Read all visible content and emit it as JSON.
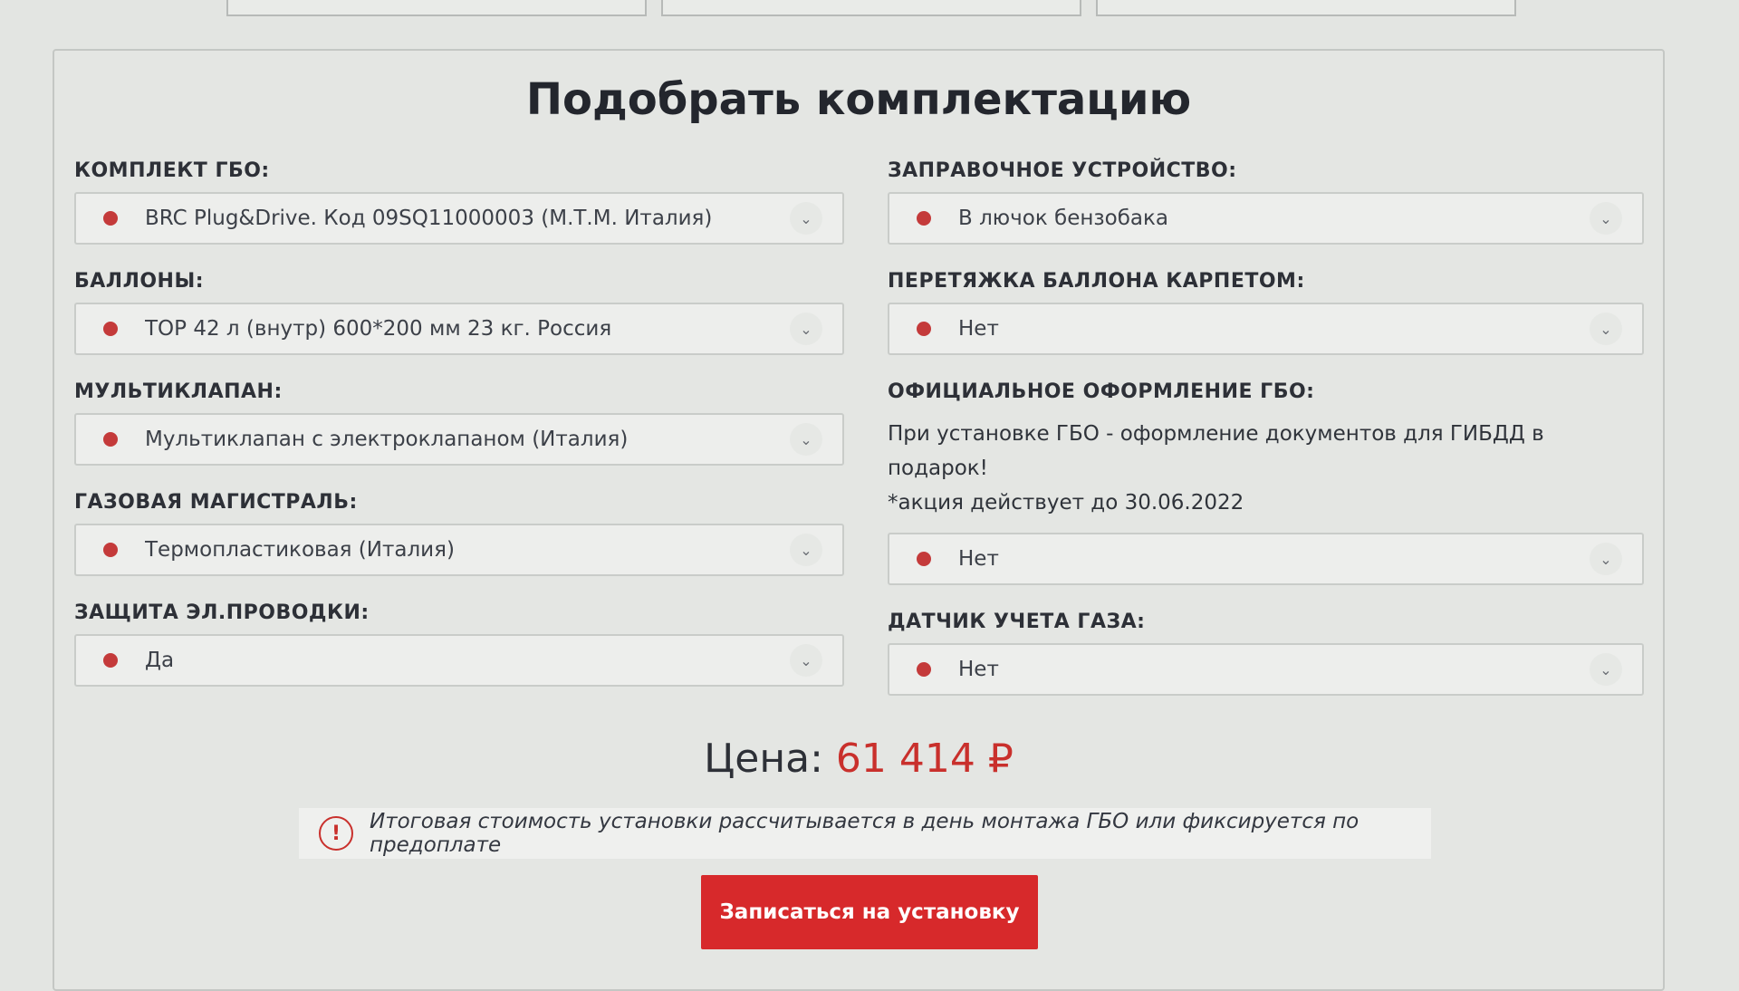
{
  "title": "Подобрать комплектацию",
  "left_fields": [
    {
      "label": "КОМПЛЕКТ ГБО:",
      "value": "BRC Plug&Drive. Код 09SQ11000003 (М.Т.М. Италия)"
    },
    {
      "label": "БАЛЛОНЫ:",
      "value": "TOP 42 л (внутр) 600*200 мм 23 кг. Россия"
    },
    {
      "label": "МУЛЬТИКЛАПАН:",
      "value": "Мультиклапан с электроклапаном (Италия)"
    },
    {
      "label": "ГАЗОВАЯ МАГИСТРАЛЬ:",
      "value": "Термопластиковая (Италия)"
    },
    {
      "label": "ЗАЩИТА ЭЛ.ПРОВОДКИ:",
      "value": "Да"
    }
  ],
  "right_fields": {
    "refuel": {
      "label": "ЗАПРАВОЧНОЕ УСТРОЙСТВО:",
      "value": "В лючок бензобака"
    },
    "carpet": {
      "label": "ПЕРЕТЯЖКА БАЛЛОНА КАРПЕТОМ:",
      "value": "Нет"
    },
    "official": {
      "label": "ОФИЦИАЛЬНОЕ ОФОРМЛЕНИЕ ГБО:",
      "info_line1": "При установке ГБО - оформление документов для ГИБДД в подарок!",
      "info_line2": "*акция действует до 30.06.2022",
      "value": "Нет"
    },
    "sensor": {
      "label": "ДАТЧИК УЧЕТА ГАЗА:",
      "value": "Нет"
    }
  },
  "price": {
    "label": "Цена:",
    "amount": "61 414 ₽"
  },
  "notice": {
    "icon": "!",
    "text": "Итоговая стоимость установки рассчитывается в день монтажа ГБО или фиксируется по предоплате"
  },
  "cta_label": "Записаться на установку",
  "colors": {
    "accent": "#d7292b",
    "price": "#c9302c",
    "dot": "#c43a3a"
  }
}
